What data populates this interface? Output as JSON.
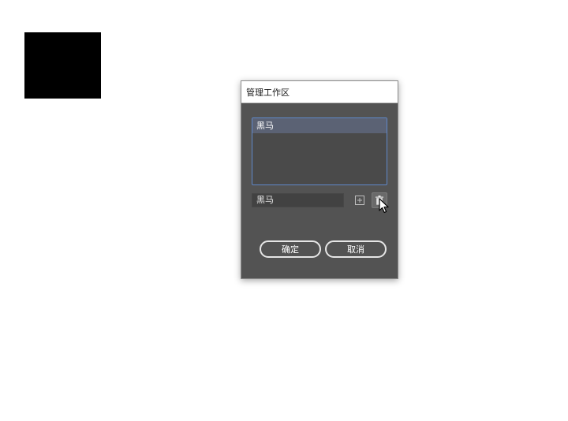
{
  "dialog": {
    "title": "管理工作区",
    "workspaces": [
      {
        "label": "黑马",
        "selected": true
      }
    ],
    "name_field_value": "黑马",
    "ok_label": "确定",
    "cancel_label": "取消",
    "icons": {
      "new": "new-workspace-icon",
      "delete": "trash-icon"
    }
  },
  "colors": {
    "dialog_bg": "#535353",
    "selection_border": "#5f88c9",
    "selected_row": "#5b6274"
  }
}
